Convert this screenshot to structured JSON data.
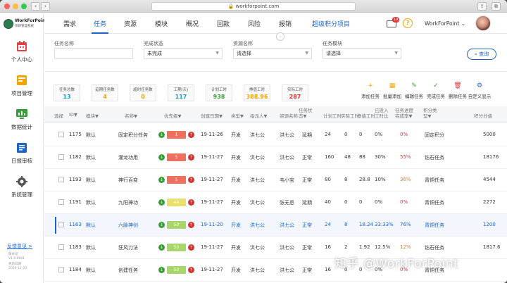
{
  "browser": {
    "url": "workforpoint.com"
  },
  "brand": {
    "name": "WorkForPoint",
    "subtitle": "项目管理系统"
  },
  "sidebar": {
    "items": [
      {
        "label": "个人中心",
        "icon": "calendar-icon"
      },
      {
        "label": "项目管理",
        "icon": "project-icon"
      },
      {
        "label": "数据统计",
        "icon": "chart-icon"
      },
      {
        "label": "日报审核",
        "icon": "report-icon"
      },
      {
        "label": "系统管理",
        "icon": "gear-icon"
      }
    ],
    "feedback": "反馈意见 >",
    "version_lines": [
      "版本号",
      "V1.0.0001",
      "更新日期",
      "2019-11-20"
    ]
  },
  "topnav": {
    "items": [
      "需求",
      "任务",
      "资源",
      "模块",
      "概况",
      "回款",
      "风险",
      "报销",
      "超级积分项目"
    ],
    "active": "任务",
    "mail_badge": "10",
    "user": "WorkForPoint ⌄"
  },
  "filters": {
    "task_name": {
      "label": "任务名称",
      "value": ""
    },
    "status": {
      "label": "完成状态",
      "value": "未完成"
    },
    "resource": {
      "label": "资源名称",
      "value": "请选择"
    },
    "module": {
      "label": "任务模块",
      "value": "请选择"
    },
    "search": "查询"
  },
  "stats": [
    {
      "label": "任务总数",
      "value": "13",
      "color": "#1a9cc8"
    },
    {
      "label": "延期任务数",
      "value": "4",
      "color": "#f0a500"
    },
    {
      "label": "超时任务数",
      "value": "0",
      "color": "#f0a500"
    },
    {
      "label": "工期(天)",
      "value": "117",
      "color": "#1a9cc8"
    },
    {
      "label": "计划工时",
      "value": "938",
      "color": "#3a9d3a"
    },
    {
      "label": "挣值工时",
      "value": "388.96",
      "color": "#f0a500"
    },
    {
      "label": "实际工时",
      "value": "287",
      "color": "#d63333"
    }
  ],
  "actions": [
    {
      "label": "添加任务",
      "color": "#f0a500",
      "icon": "add-task-icon",
      "glyph": "+"
    },
    {
      "label": "批量添加",
      "color": "#f0a500",
      "icon": "batch-add-icon",
      "glyph": "▦"
    },
    {
      "label": "编辑任务",
      "color": "#3a9d3a",
      "icon": "edit-icon",
      "glyph": "✎"
    },
    {
      "label": "完成任务",
      "color": "#3a9d3a",
      "icon": "complete-icon",
      "glyph": "✓"
    },
    {
      "label": "删除任务",
      "color": "#d63333",
      "icon": "delete-icon",
      "glyph": "🗑"
    },
    {
      "label": "自定义显示",
      "color": "#1a64c8",
      "icon": "settings-icon",
      "glyph": "⚙"
    }
  ],
  "table": {
    "headers": [
      "选择",
      "ID▼",
      "模块▼",
      "名称▼",
      "优先级▼",
      "创建日期▼",
      "类型▼",
      "指派人▼",
      "资源名称",
      "任务状态▼",
      "计划工时",
      "实际工时",
      "挣值工时",
      "已投入工时比",
      "任务进度完成率▼",
      "积分类型▼",
      "积分分值"
    ],
    "rows": [
      {
        "id": "1175",
        "module": "默认",
        "name": "固定积分任务",
        "pri": "1",
        "pri_color": "#f07060",
        "date": "19-11-26",
        "type": "开发",
        "assignee": "洪七公",
        "resource": "洪七公",
        "status": "延期",
        "plan": "24",
        "actual": "0",
        "earned": "0",
        "ratio": "0%",
        "progress": "0%",
        "points_type": "固定积分",
        "points": "5000"
      },
      {
        "id": "1182",
        "module": "默认",
        "name": "灌龙功用",
        "pri": "5",
        "pri_color": "#f07060",
        "date": "19-11-27",
        "type": "开发",
        "assignee": "洪七公",
        "resource": "洪七公",
        "status": "正常",
        "plan": "160",
        "actual": "48",
        "earned": "88",
        "ratio": "30%",
        "progress": "55%",
        "points_type": "钻石任务",
        "points": "18176"
      },
      {
        "id": "1193",
        "module": "默认",
        "name": "神行百变",
        "pri": "5",
        "pri_color": "#f07060",
        "date": "19-11-27",
        "type": "开发",
        "assignee": "洪七公",
        "resource": "韦小宝",
        "status": "正常",
        "plan": "80",
        "actual": "8",
        "earned": "28.8",
        "ratio": "10%",
        "progress": "36%",
        "points_type": "青铜任务",
        "points": "4544"
      },
      {
        "id": "1191",
        "module": "默认",
        "name": "九阳神功",
        "pri": "44",
        "pri_color": "#e8e06a",
        "date": "19-11-27",
        "type": "开发",
        "assignee": "洪七公",
        "resource": "张无忌",
        "status": "延期",
        "plan": "40",
        "actual": "0",
        "earned": "0",
        "ratio": "0%",
        "progress": "0%",
        "points_type": "青铜任务",
        "points": "2272"
      },
      {
        "id": "1163",
        "module": "默认",
        "name": "六脉神剑",
        "pri": "50",
        "pri_color": "#a8d66a",
        "date": "19-11-20",
        "type": "开发",
        "assignee": "洪七公",
        "resource": "洪七公",
        "status": "正常",
        "plan": "24",
        "actual": "8",
        "earned": "18.24",
        "ratio": "33.33%",
        "progress": "76%",
        "points_type": "青铜任务",
        "points": "1200"
      },
      {
        "id": "1183",
        "module": "默认",
        "name": "狂风刀法",
        "pri": "50",
        "pri_color": "#a8d66a",
        "date": "19-11-27",
        "type": "开发",
        "assignee": "洪七公",
        "resource": "洪七公",
        "status": "正常",
        "plan": "16",
        "actual": "2",
        "earned": "1.92",
        "ratio": "12.5%",
        "progress": "12%",
        "points_type": "钻石任务",
        "points": "1817.6"
      },
      {
        "id": "1184",
        "module": "默认",
        "name": "创建任务",
        "pri": "50",
        "pri_color": "#a8d66a",
        "date": "19-11-27",
        "type": "开发",
        "assignee": "洪七公",
        "resource": "洪七公",
        "status": "正常",
        "plan": "16",
        "actual": "0",
        "earned": "0",
        "ratio": "0%",
        "progress": "0%",
        "points_type": "青铜任务",
        "points": ""
      }
    ]
  },
  "watermark": "知乎 @WorkForPoint"
}
